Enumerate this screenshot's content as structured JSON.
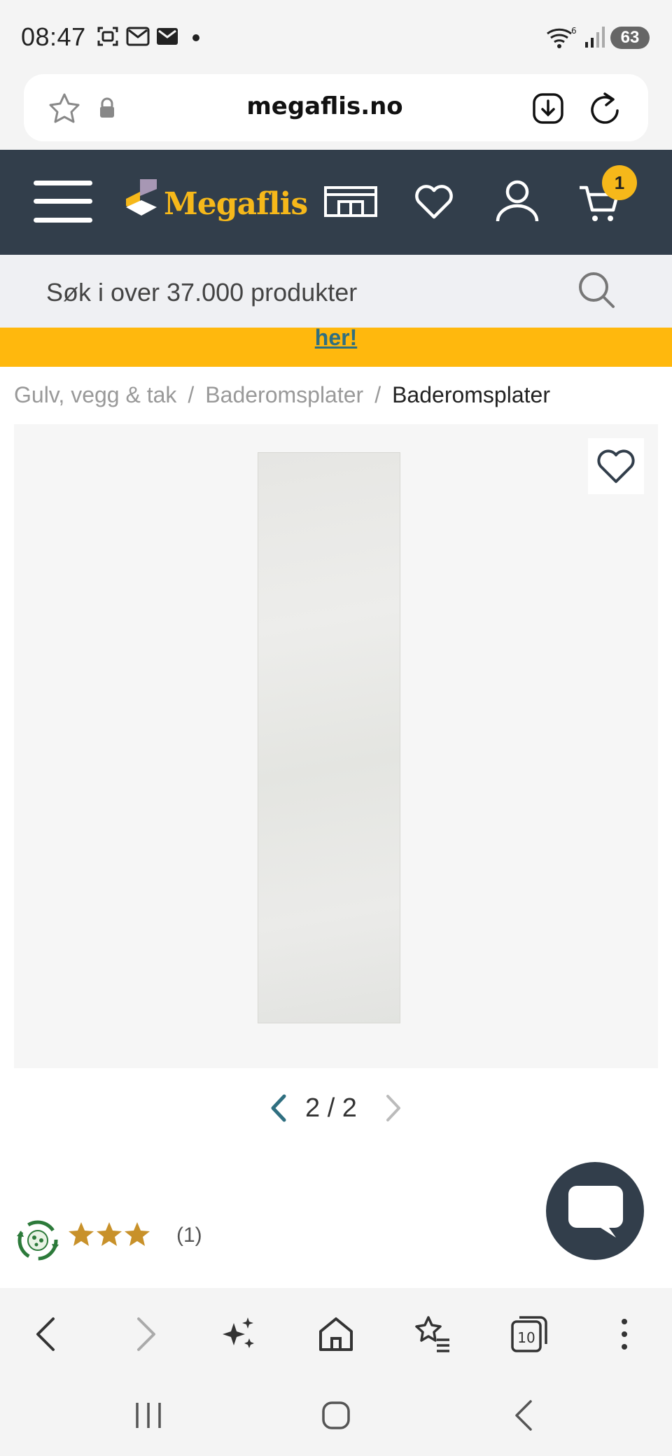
{
  "status_bar": {
    "time": "08:47",
    "battery": "63",
    "icons": [
      "screenshot-icon",
      "mail-icon",
      "mail-filled-icon",
      "dot-icon",
      "wifi-6-icon",
      "signal-icon"
    ]
  },
  "browser": {
    "url": "megaflis.no",
    "icons": [
      "star-icon",
      "lock-icon",
      "download-icon",
      "reload-icon"
    ],
    "bottom_nav": [
      "back-icon",
      "forward-icon",
      "sparkle-icon",
      "home-icon",
      "bookmarks-icon",
      "tabs-icon",
      "more-icon"
    ],
    "tab_count": "10"
  },
  "site_header": {
    "logo": "Megaflis",
    "cart_count": "1",
    "icons": [
      "menu-icon",
      "showroom-icon",
      "heart-icon",
      "user-icon",
      "cart-icon"
    ],
    "brand_color": "#323e4b",
    "accent_color": "#f6b81a"
  },
  "search": {
    "placeholder": "Søk i over 37.000 produkter"
  },
  "promo_banner": {
    "link_text": "her!",
    "background": "#ffb80d"
  },
  "breadcrumb": {
    "items": [
      "Gulv, vegg & tak",
      "Baderomsplater",
      "Baderomsplater"
    ],
    "separator": "/"
  },
  "gallery": {
    "current": "2",
    "total": "2",
    "pager_text": "2 / 2"
  },
  "product": {
    "rating_stars": 3,
    "review_count": "(1)"
  }
}
